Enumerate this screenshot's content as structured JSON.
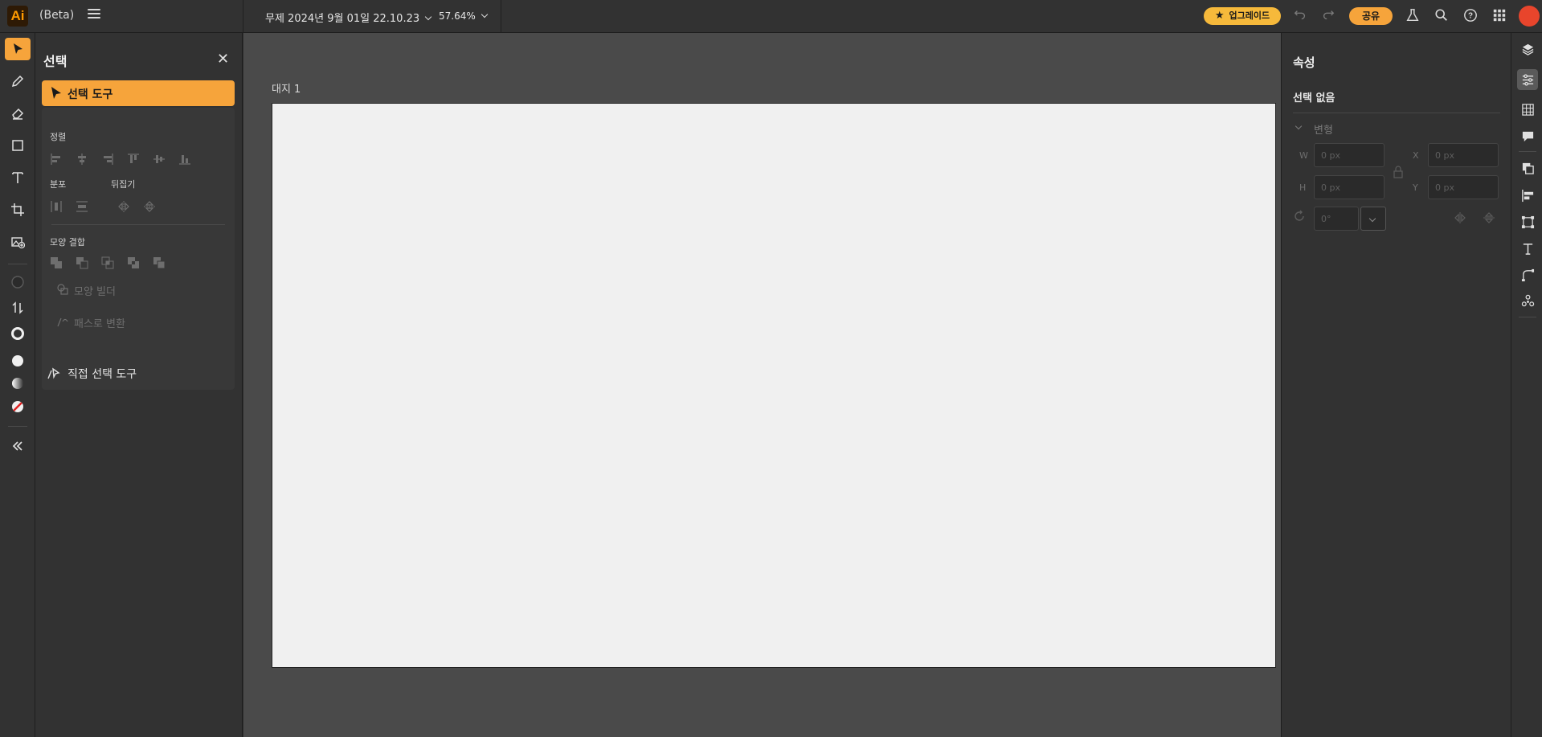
{
  "app": {
    "logo_text": "Ai",
    "beta_label": "(Beta)",
    "document_name": "무제 2024년 9월 01일 22.10.23",
    "zoom_level": "57.64%",
    "upgrade_label": "업그레이드",
    "share_label": "공유",
    "brand_color": "#f6a43b"
  },
  "toolbar": {
    "tools": [
      "select-tool",
      "pencil-tool",
      "eraser-tool",
      "rectangle-tool",
      "type-tool",
      "artboard-tool",
      "image-tool"
    ],
    "color_tools": [
      "fill-swatch",
      "swap-colors",
      "stroke-swatch",
      "white-color",
      "gradient",
      "none-color"
    ],
    "collapse_label": "«"
  },
  "selection_panel": {
    "title": "선택",
    "active_tool": "선택 도구",
    "align_label": "정렬",
    "distribute_label": "분포",
    "flip_label": "뒤집기",
    "combine_label": "모양 결합",
    "shape_builder_label": "모양 빌더",
    "convert_path_label": "패스로 변환",
    "direct_select_label": "직접 선택 도구"
  },
  "canvas": {
    "artboard_label": "대지 1"
  },
  "properties": {
    "title": "속성",
    "selection_state": "선택 없음",
    "transform_label": "변형",
    "w_label": "W",
    "h_label": "H",
    "x_label": "X",
    "y_label": "Y",
    "w_value": "0 px",
    "h_value": "0 px",
    "x_value": "0 px",
    "y_value": "0 px",
    "rotate_value": "0°"
  }
}
